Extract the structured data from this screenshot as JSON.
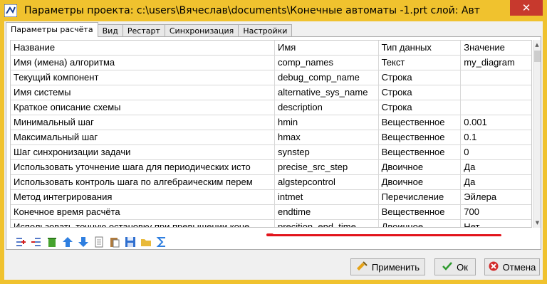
{
  "window": {
    "title": "Параметры проекта: c:\\users\\Вячеслав\\documents\\Конечные автоматы -1.prt  слой: Авто...",
    "close_glyph": "✕"
  },
  "tabs": [
    {
      "label": "Параметры расчёта",
      "active": true
    },
    {
      "label": "Вид"
    },
    {
      "label": "Рестарт"
    },
    {
      "label": "Синхронизация"
    },
    {
      "label": "Настройки"
    }
  ],
  "table": {
    "columns": [
      "Название",
      "Имя",
      "Тип данных",
      "Значение"
    ],
    "rows": [
      [
        "Имя (имена) алгоритма",
        "comp_names",
        "Текст",
        "my_diagram"
      ],
      [
        "Текущий компонент",
        "debug_comp_name",
        "Строка",
        ""
      ],
      [
        "Имя системы",
        "alternative_sys_name",
        "Строка",
        ""
      ],
      [
        "Краткое описание схемы",
        "description",
        "Строка",
        ""
      ],
      [
        "Минимальный шаг",
        "hmin",
        "Вещественное",
        "0.001"
      ],
      [
        "Максимальный шаг",
        "hmax",
        "Вещественное",
        "0.1"
      ],
      [
        "Шаг синхронизации задачи",
        "synstep",
        "Вещественное",
        "0"
      ],
      [
        "Использовать уточнение шага для периодических исто",
        "precise_src_step",
        "Двоичное",
        "Да"
      ],
      [
        "Использовать контроль шага по алгебраическим перем",
        "algstepcontrol",
        "Двоичное",
        "Да"
      ],
      [
        "Метод интегрирования",
        "intmet",
        "Перечисление",
        "Эйлера"
      ],
      [
        "Конечное время расчёта",
        "endtime",
        "Вещественное",
        "700"
      ],
      [
        "Использовать точную остановку при превышении коне",
        "precition_end_time",
        "Двоичное",
        "Нет"
      ]
    ]
  },
  "toolbar_icons": [
    "add-rows-icon",
    "remove-rows-icon",
    "delete-icon",
    "move-up-icon",
    "move-down-icon",
    "copy-icon",
    "paste-icon",
    "save-icon",
    "open-folder-icon",
    "sum-icon"
  ],
  "buttons": {
    "apply": "Применить",
    "ok": "Ок",
    "cancel": "Отмена"
  },
  "colors": {
    "title_bar": "#f0c22e",
    "highlight_underline": "#e2141b",
    "close_button": "#c7392d"
  }
}
